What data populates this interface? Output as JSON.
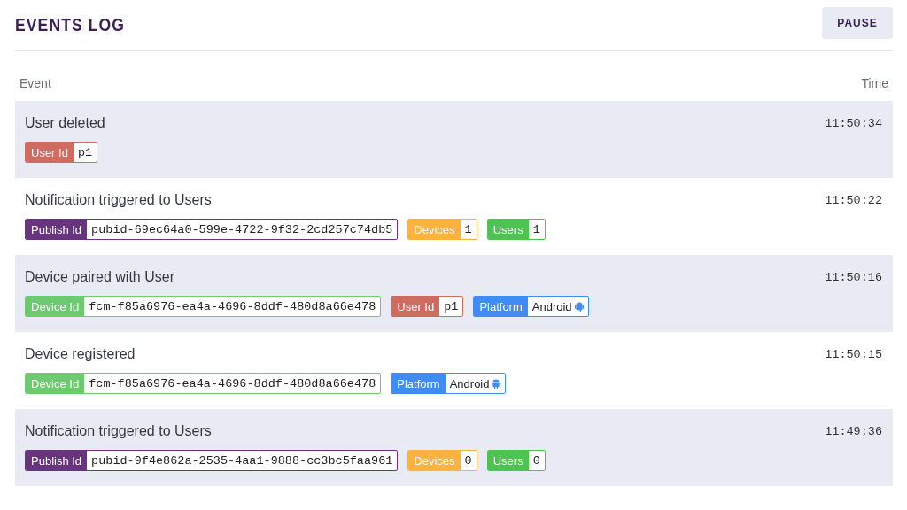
{
  "header": {
    "title": "EVENTS LOG",
    "pause_button": "PAUSE"
  },
  "columns": {
    "event": "Event",
    "time": "Time"
  },
  "events": [
    {
      "title": "User deleted",
      "time": "11:50:34",
      "tags": [
        {
          "kind": "mono",
          "label": "User Id",
          "value": "p1",
          "color": "#cf6b61"
        }
      ]
    },
    {
      "title": "Notification triggered to Users",
      "time": "11:50:22",
      "tags": [
        {
          "kind": "mono",
          "label": "Publish Id",
          "value": "pubid-69ec64a0-599e-4722-9f32-2cd257c74db5",
          "color": "#69347e"
        },
        {
          "kind": "mono",
          "label": "Devices",
          "value": "1",
          "color": "#fbb23f"
        },
        {
          "kind": "mono",
          "label": "Users",
          "value": "1",
          "color": "#4dc452"
        }
      ]
    },
    {
      "title": "Device paired with User",
      "time": "11:50:16",
      "tags": [
        {
          "kind": "mono",
          "label": "Device Id",
          "value": "fcm-f85a6976-ea4a-4696-8ddf-480d8a66e478",
          "color": "#6ccb71"
        },
        {
          "kind": "mono",
          "label": "User Id",
          "value": "p1",
          "color": "#cf6b61"
        },
        {
          "kind": "platform",
          "label": "Platform",
          "value": "Android",
          "color": "#3f8cf6"
        }
      ]
    },
    {
      "title": "Device registered",
      "time": "11:50:15",
      "tags": [
        {
          "kind": "mono",
          "label": "Device Id",
          "value": "fcm-f85a6976-ea4a-4696-8ddf-480d8a66e478",
          "color": "#6ccb71"
        },
        {
          "kind": "platform",
          "label": "Platform",
          "value": "Android",
          "color": "#3f8cf6"
        }
      ]
    },
    {
      "title": "Notification triggered to Users",
      "time": "11:49:36",
      "tags": [
        {
          "kind": "mono",
          "label": "Publish Id",
          "value": "pubid-9f4e862a-2535-4aa1-9888-cc3bc5faa961",
          "color": "#69347e"
        },
        {
          "kind": "mono",
          "label": "Devices",
          "value": "0",
          "color": "#fbb23f"
        },
        {
          "kind": "mono",
          "label": "Users",
          "value": "0",
          "color": "#4dc452"
        }
      ]
    }
  ]
}
